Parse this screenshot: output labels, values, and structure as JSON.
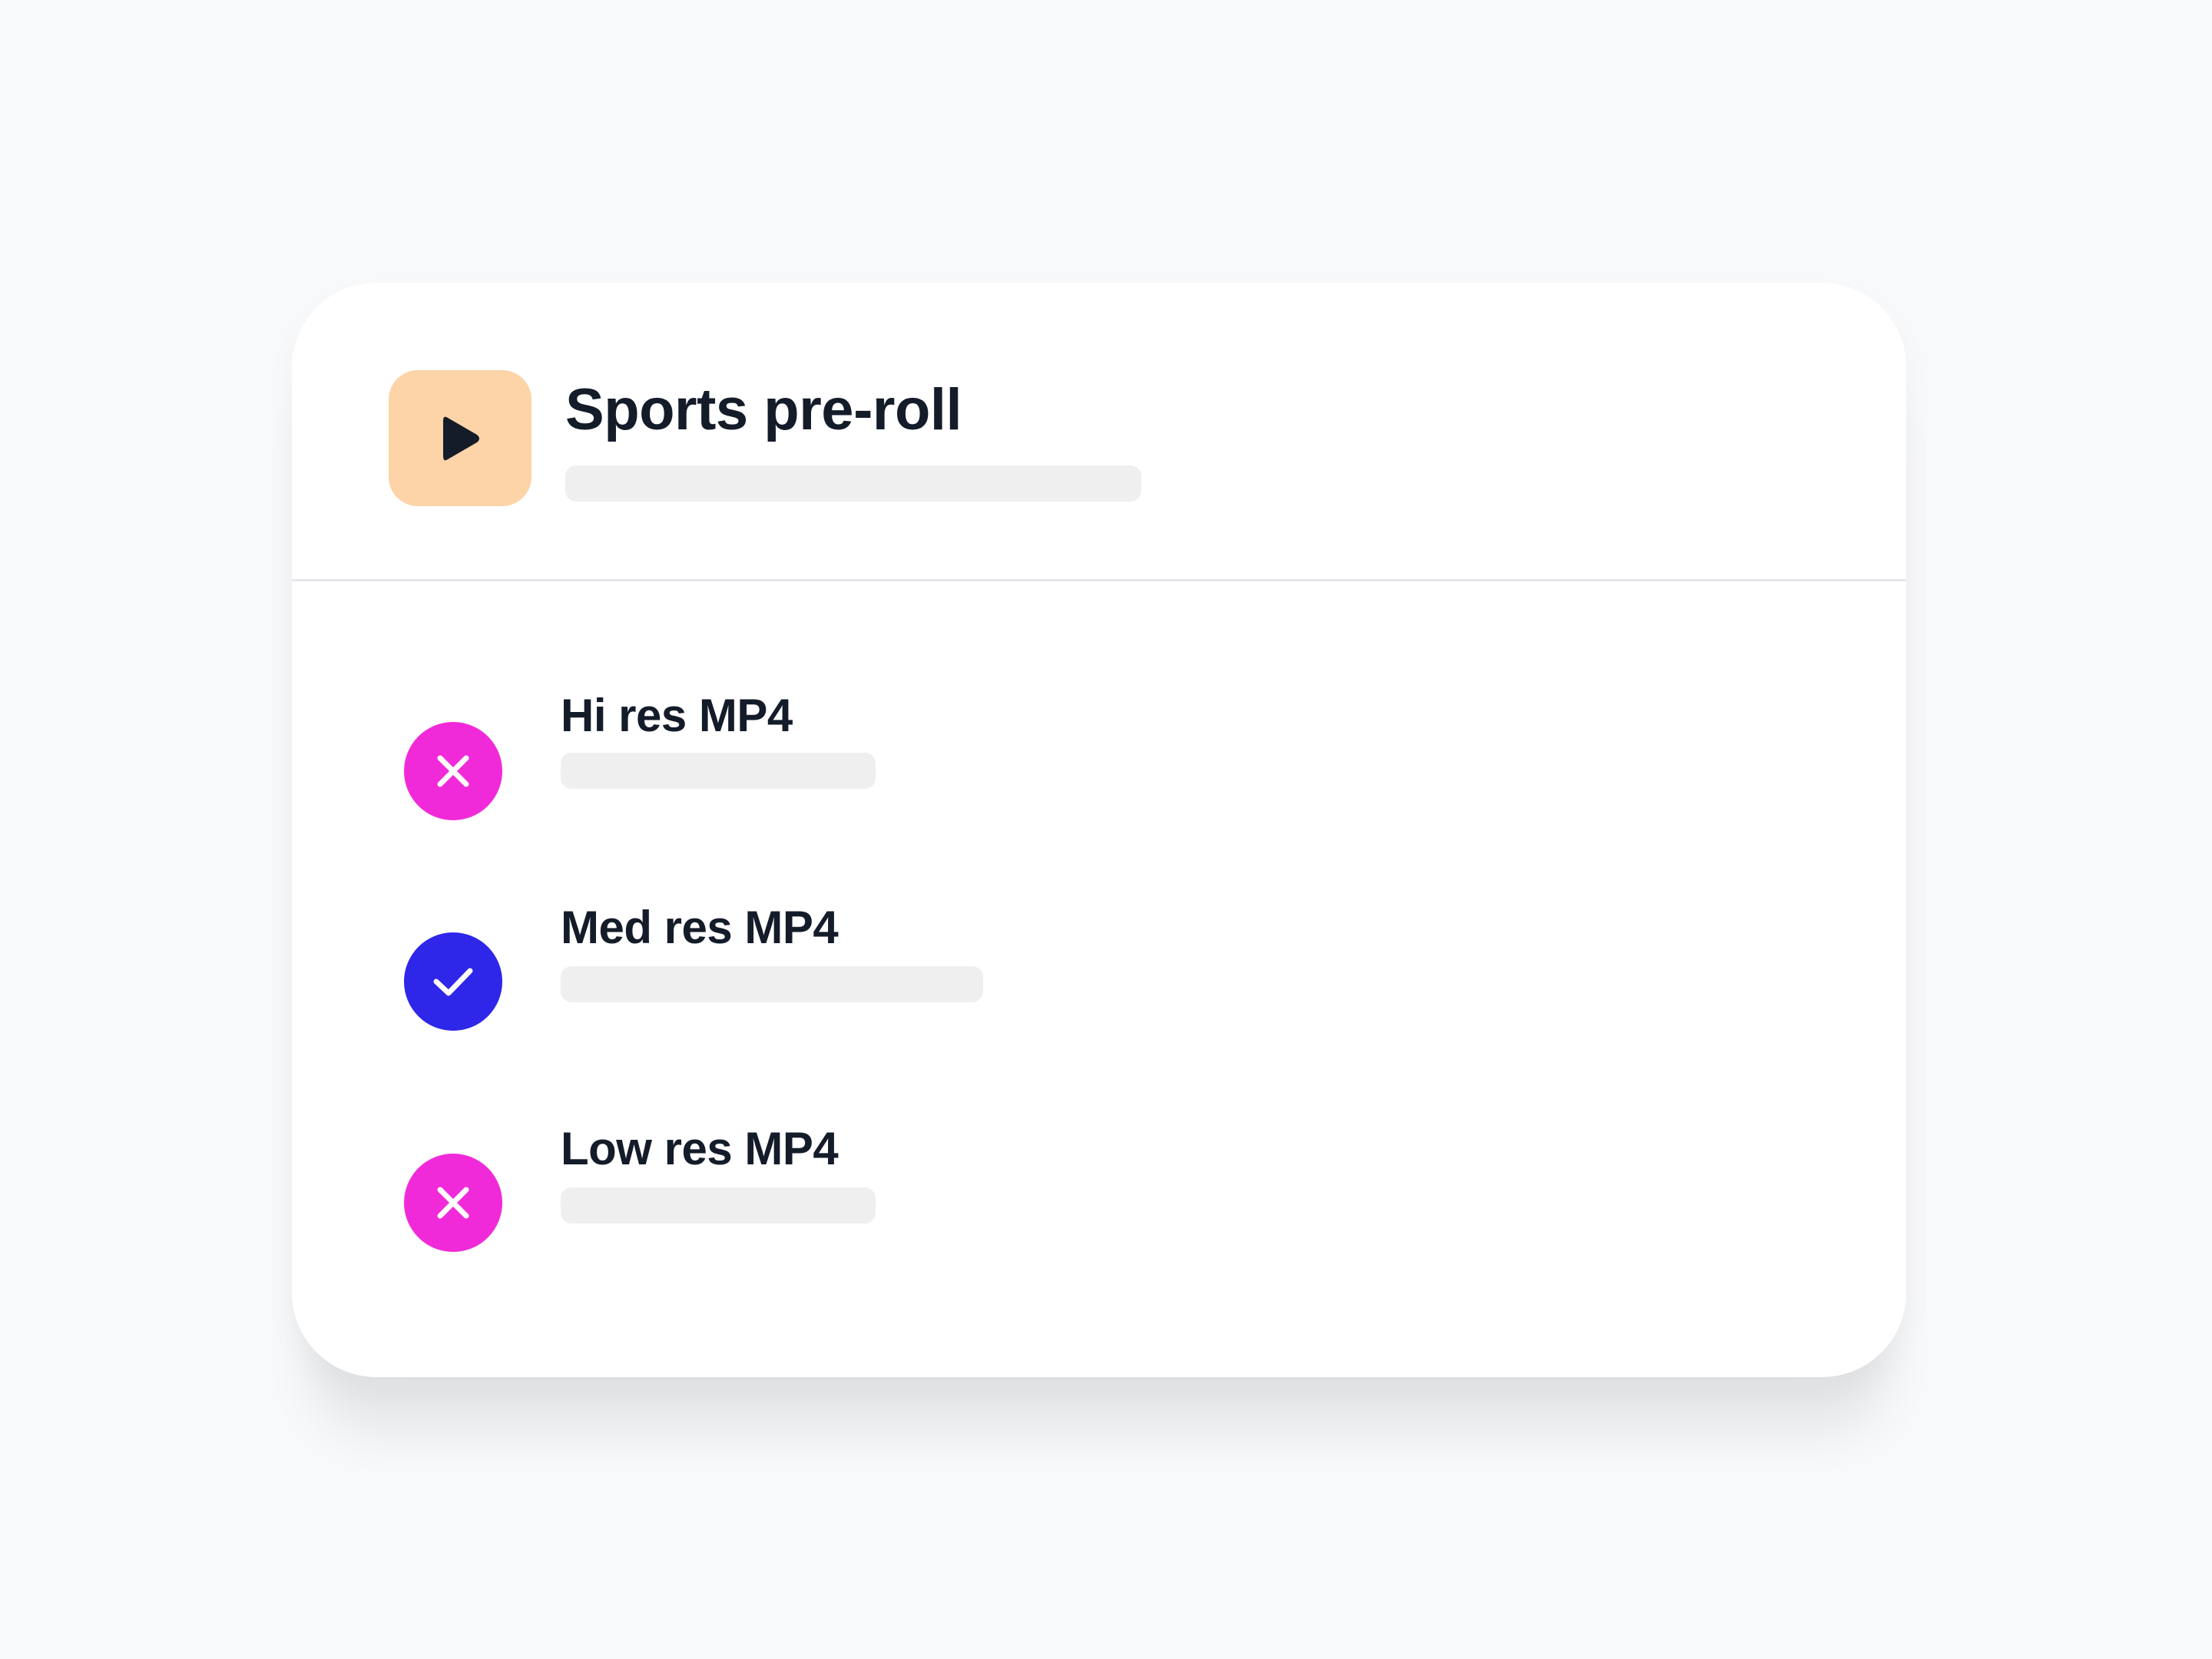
{
  "card": {
    "title": "Sports pre-roll",
    "thumbnail_icon": "play-icon",
    "thumbnail_color": "#fdd3a8"
  },
  "renditions": [
    {
      "label": "Hi res MP4",
      "status": "failed",
      "status_icon": "close-icon",
      "status_color": "#f12ad9"
    },
    {
      "label": "Med res MP4",
      "status": "success",
      "status_icon": "check-icon",
      "status_color": "#2e26e9"
    },
    {
      "label": "Low res MP4",
      "status": "failed",
      "status_icon": "close-icon",
      "status_color": "#f12ad9"
    }
  ],
  "colors": {
    "text": "#141c2a",
    "background": "#f8f9fb",
    "card": "#ffffff",
    "skeleton": "#efefef"
  }
}
